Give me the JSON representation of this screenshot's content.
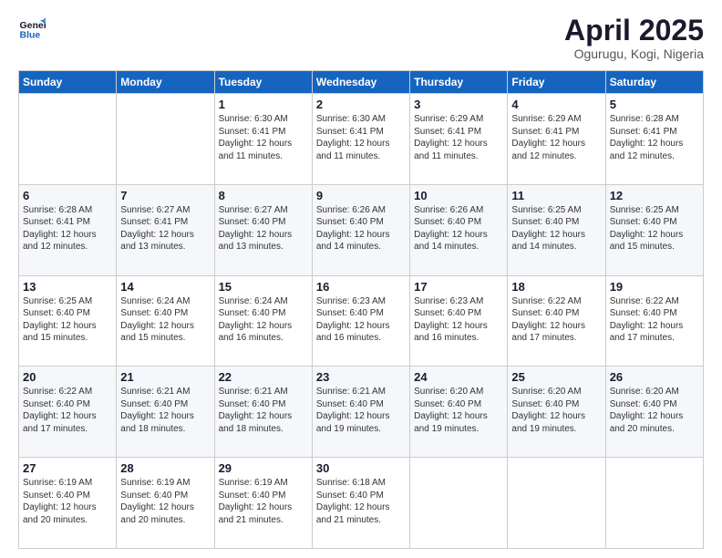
{
  "header": {
    "logo_line1": "General",
    "logo_line2": "Blue",
    "month_title": "April 2025",
    "location": "Ogurugu, Kogi, Nigeria"
  },
  "weekdays": [
    "Sunday",
    "Monday",
    "Tuesday",
    "Wednesday",
    "Thursday",
    "Friday",
    "Saturday"
  ],
  "weeks": [
    [
      {
        "day": "",
        "sunrise": "",
        "sunset": "",
        "daylight": ""
      },
      {
        "day": "",
        "sunrise": "",
        "sunset": "",
        "daylight": ""
      },
      {
        "day": "1",
        "sunrise": "Sunrise: 6:30 AM",
        "sunset": "Sunset: 6:41 PM",
        "daylight": "Daylight: 12 hours and 11 minutes."
      },
      {
        "day": "2",
        "sunrise": "Sunrise: 6:30 AM",
        "sunset": "Sunset: 6:41 PM",
        "daylight": "Daylight: 12 hours and 11 minutes."
      },
      {
        "day": "3",
        "sunrise": "Sunrise: 6:29 AM",
        "sunset": "Sunset: 6:41 PM",
        "daylight": "Daylight: 12 hours and 11 minutes."
      },
      {
        "day": "4",
        "sunrise": "Sunrise: 6:29 AM",
        "sunset": "Sunset: 6:41 PM",
        "daylight": "Daylight: 12 hours and 12 minutes."
      },
      {
        "day": "5",
        "sunrise": "Sunrise: 6:28 AM",
        "sunset": "Sunset: 6:41 PM",
        "daylight": "Daylight: 12 hours and 12 minutes."
      }
    ],
    [
      {
        "day": "6",
        "sunrise": "Sunrise: 6:28 AM",
        "sunset": "Sunset: 6:41 PM",
        "daylight": "Daylight: 12 hours and 12 minutes."
      },
      {
        "day": "7",
        "sunrise": "Sunrise: 6:27 AM",
        "sunset": "Sunset: 6:41 PM",
        "daylight": "Daylight: 12 hours and 13 minutes."
      },
      {
        "day": "8",
        "sunrise": "Sunrise: 6:27 AM",
        "sunset": "Sunset: 6:40 PM",
        "daylight": "Daylight: 12 hours and 13 minutes."
      },
      {
        "day": "9",
        "sunrise": "Sunrise: 6:26 AM",
        "sunset": "Sunset: 6:40 PM",
        "daylight": "Daylight: 12 hours and 14 minutes."
      },
      {
        "day": "10",
        "sunrise": "Sunrise: 6:26 AM",
        "sunset": "Sunset: 6:40 PM",
        "daylight": "Daylight: 12 hours and 14 minutes."
      },
      {
        "day": "11",
        "sunrise": "Sunrise: 6:25 AM",
        "sunset": "Sunset: 6:40 PM",
        "daylight": "Daylight: 12 hours and 14 minutes."
      },
      {
        "day": "12",
        "sunrise": "Sunrise: 6:25 AM",
        "sunset": "Sunset: 6:40 PM",
        "daylight": "Daylight: 12 hours and 15 minutes."
      }
    ],
    [
      {
        "day": "13",
        "sunrise": "Sunrise: 6:25 AM",
        "sunset": "Sunset: 6:40 PM",
        "daylight": "Daylight: 12 hours and 15 minutes."
      },
      {
        "day": "14",
        "sunrise": "Sunrise: 6:24 AM",
        "sunset": "Sunset: 6:40 PM",
        "daylight": "Daylight: 12 hours and 15 minutes."
      },
      {
        "day": "15",
        "sunrise": "Sunrise: 6:24 AM",
        "sunset": "Sunset: 6:40 PM",
        "daylight": "Daylight: 12 hours and 16 minutes."
      },
      {
        "day": "16",
        "sunrise": "Sunrise: 6:23 AM",
        "sunset": "Sunset: 6:40 PM",
        "daylight": "Daylight: 12 hours and 16 minutes."
      },
      {
        "day": "17",
        "sunrise": "Sunrise: 6:23 AM",
        "sunset": "Sunset: 6:40 PM",
        "daylight": "Daylight: 12 hours and 16 minutes."
      },
      {
        "day": "18",
        "sunrise": "Sunrise: 6:22 AM",
        "sunset": "Sunset: 6:40 PM",
        "daylight": "Daylight: 12 hours and 17 minutes."
      },
      {
        "day": "19",
        "sunrise": "Sunrise: 6:22 AM",
        "sunset": "Sunset: 6:40 PM",
        "daylight": "Daylight: 12 hours and 17 minutes."
      }
    ],
    [
      {
        "day": "20",
        "sunrise": "Sunrise: 6:22 AM",
        "sunset": "Sunset: 6:40 PM",
        "daylight": "Daylight: 12 hours and 17 minutes."
      },
      {
        "day": "21",
        "sunrise": "Sunrise: 6:21 AM",
        "sunset": "Sunset: 6:40 PM",
        "daylight": "Daylight: 12 hours and 18 minutes."
      },
      {
        "day": "22",
        "sunrise": "Sunrise: 6:21 AM",
        "sunset": "Sunset: 6:40 PM",
        "daylight": "Daylight: 12 hours and 18 minutes."
      },
      {
        "day": "23",
        "sunrise": "Sunrise: 6:21 AM",
        "sunset": "Sunset: 6:40 PM",
        "daylight": "Daylight: 12 hours and 19 minutes."
      },
      {
        "day": "24",
        "sunrise": "Sunrise: 6:20 AM",
        "sunset": "Sunset: 6:40 PM",
        "daylight": "Daylight: 12 hours and 19 minutes."
      },
      {
        "day": "25",
        "sunrise": "Sunrise: 6:20 AM",
        "sunset": "Sunset: 6:40 PM",
        "daylight": "Daylight: 12 hours and 19 minutes."
      },
      {
        "day": "26",
        "sunrise": "Sunrise: 6:20 AM",
        "sunset": "Sunset: 6:40 PM",
        "daylight": "Daylight: 12 hours and 20 minutes."
      }
    ],
    [
      {
        "day": "27",
        "sunrise": "Sunrise: 6:19 AM",
        "sunset": "Sunset: 6:40 PM",
        "daylight": "Daylight: 12 hours and 20 minutes."
      },
      {
        "day": "28",
        "sunrise": "Sunrise: 6:19 AM",
        "sunset": "Sunset: 6:40 PM",
        "daylight": "Daylight: 12 hours and 20 minutes."
      },
      {
        "day": "29",
        "sunrise": "Sunrise: 6:19 AM",
        "sunset": "Sunset: 6:40 PM",
        "daylight": "Daylight: 12 hours and 21 minutes."
      },
      {
        "day": "30",
        "sunrise": "Sunrise: 6:18 AM",
        "sunset": "Sunset: 6:40 PM",
        "daylight": "Daylight: 12 hours and 21 minutes."
      },
      {
        "day": "",
        "sunrise": "",
        "sunset": "",
        "daylight": ""
      },
      {
        "day": "",
        "sunrise": "",
        "sunset": "",
        "daylight": ""
      },
      {
        "day": "",
        "sunrise": "",
        "sunset": "",
        "daylight": ""
      }
    ]
  ]
}
